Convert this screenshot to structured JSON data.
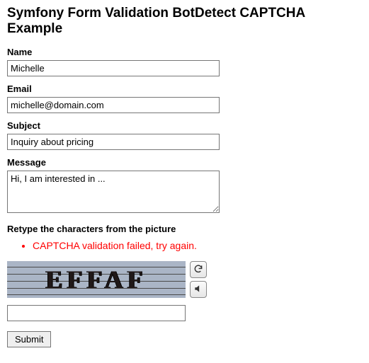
{
  "heading": "Symfony Form Validation BotDetect CAPTCHA Example",
  "fields": {
    "name": {
      "label": "Name",
      "value": "Michelle"
    },
    "email": {
      "label": "Email",
      "value": "michelle@domain.com"
    },
    "subject": {
      "label": "Subject",
      "value": "Inquiry about pricing"
    },
    "message": {
      "label": "Message",
      "value": "Hi, I am interested in ..."
    }
  },
  "captcha": {
    "label": "Retype the characters from the picture",
    "error": "CAPTCHA validation failed, try again.",
    "image_text": "EFFAF",
    "input_value": ""
  },
  "submit_label": "Submit"
}
